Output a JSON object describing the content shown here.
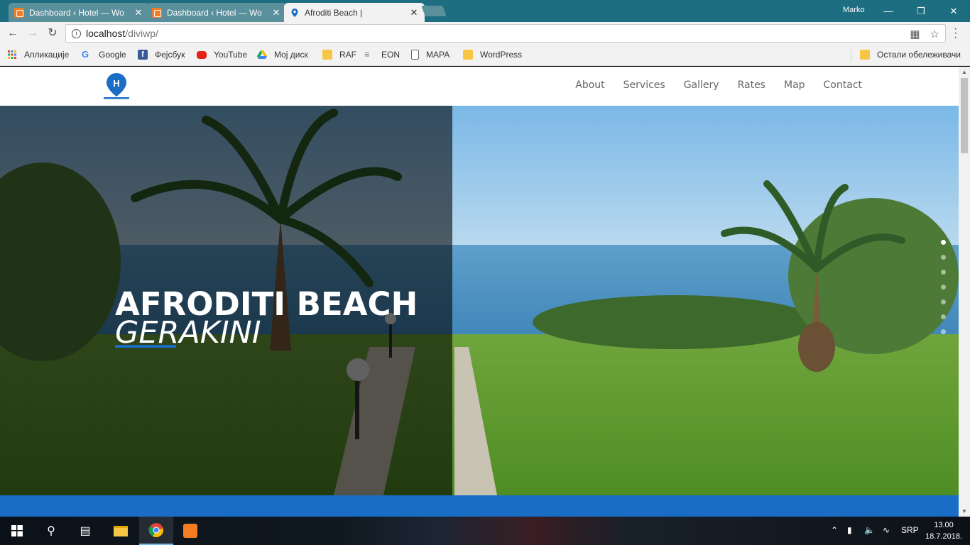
{
  "browser": {
    "tabs": [
      {
        "title": "Dashboard ‹ Hotel — Wo"
      },
      {
        "title": "Dashboard ‹ Hotel — Wo"
      },
      {
        "title": "Afroditi Beach |"
      }
    ],
    "user": "Marko",
    "address": {
      "host": "localhost",
      "path": "/diviwp/"
    },
    "bookmarks": [
      {
        "label": "Апликације",
        "icon": "apps-icon",
        "color": "#e0452a"
      },
      {
        "label": "Google",
        "icon": "google-icon",
        "color": "#4285f4"
      },
      {
        "label": "Фејсбук",
        "icon": "facebook-icon",
        "color": "#3b5998"
      },
      {
        "label": "YouTube",
        "icon": "youtube-icon",
        "color": "#e62117"
      },
      {
        "label": "Мој диск",
        "icon": "drive-icon",
        "color": "#1da462"
      },
      {
        "label": "RAF",
        "icon": "folder-icon",
        "color": "#f6c644"
      },
      {
        "label": "EON",
        "icon": "eon-icon",
        "color": "#7b7b9a"
      },
      {
        "label": "МАРА",
        "icon": "page-icon",
        "color": "#ffffff"
      },
      {
        "label": "WordPress",
        "icon": "folder-icon",
        "color": "#f6c644"
      }
    ],
    "other_bookmarks": "Остали обележивачи"
  },
  "site": {
    "nav": [
      "About",
      "Services",
      "Gallery",
      "Rates",
      "Map",
      "Contact"
    ],
    "hero": {
      "title": "AFRODITI BEACH",
      "subtitle": "GERAKINI"
    },
    "slider_dots": 7,
    "active_dot": 0,
    "accent": "#1a6dc5"
  },
  "taskbar": {
    "language": "SRP",
    "time": "13.00",
    "date": "18.7.2018."
  }
}
